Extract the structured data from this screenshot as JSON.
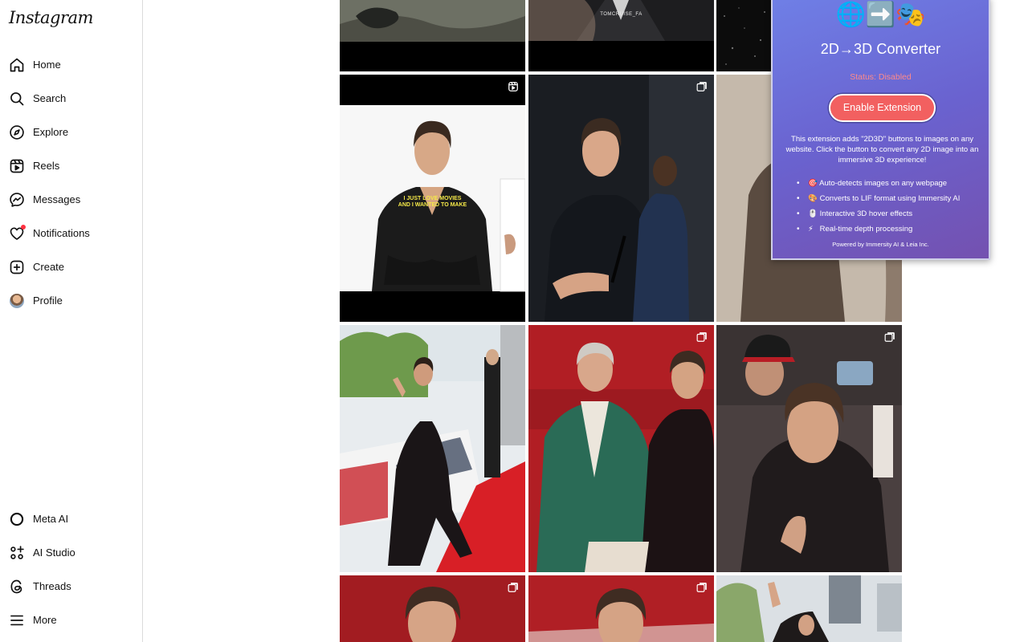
{
  "app": {
    "logo": "Instagram"
  },
  "sidebar": {
    "items": [
      {
        "label": "Home",
        "icon": "home-icon"
      },
      {
        "label": "Search",
        "icon": "search-icon"
      },
      {
        "label": "Explore",
        "icon": "compass-icon"
      },
      {
        "label": "Reels",
        "icon": "reels-icon"
      },
      {
        "label": "Messages",
        "icon": "messenger-icon"
      },
      {
        "label": "Notifications",
        "icon": "heart-icon"
      },
      {
        "label": "Create",
        "icon": "plus-square-icon"
      },
      {
        "label": "Profile",
        "icon": "avatar"
      }
    ],
    "bottom_items": [
      {
        "label": "Meta AI",
        "icon": "meta-ai-icon"
      },
      {
        "label": "AI Studio",
        "icon": "ai-studio-icon"
      },
      {
        "label": "Threads",
        "icon": "threads-icon"
      },
      {
        "label": "More",
        "icon": "menu-icon"
      }
    ]
  },
  "grid": {
    "tiles": [
      {
        "name": "post-1",
        "badge": "none",
        "caption": ""
      },
      {
        "name": "post-2",
        "badge": "none",
        "caption": "TOMCRUISE_FA"
      },
      {
        "name": "post-3",
        "badge": "none",
        "caption": ""
      },
      {
        "name": "post-4",
        "badge": "reel-icon",
        "caption": "I JUST LOVE MOVIES\nAND I WANTED TO MAKE"
      },
      {
        "name": "post-5",
        "badge": "carousel-icon",
        "caption": ""
      },
      {
        "name": "post-6",
        "badge": "none",
        "caption": ""
      },
      {
        "name": "post-7",
        "badge": "none",
        "caption": ""
      },
      {
        "name": "post-8",
        "badge": "carousel-icon",
        "caption": ""
      },
      {
        "name": "post-9",
        "badge": "carousel-icon",
        "caption": ""
      },
      {
        "name": "post-10",
        "badge": "carousel-icon",
        "caption": ""
      },
      {
        "name": "post-11",
        "badge": "carousel-icon",
        "caption": ""
      },
      {
        "name": "post-12",
        "badge": "none",
        "caption": ""
      }
    ],
    "reel_caption_line1": "I JUST LOVE MOVIES",
    "reel_caption_line2": "AND I WANTED TO MAKE",
    "top_caption": "TOMCRUISE_FA"
  },
  "extension": {
    "emojis": "🌐➡️🎭",
    "title": "2D→3D Converter",
    "status": "Status: Disabled",
    "button_label": "Enable Extension",
    "description": "This extension adds \"2D3D\" buttons to images on any website. Click the button to convert any 2D image into an immersive 3D experience!",
    "features": [
      {
        "emoji": "🎯",
        "text": "Auto-detects images on any webpage"
      },
      {
        "emoji": "🎨",
        "text": "Converts to LIF format using Immersity AI"
      },
      {
        "emoji": "🖱️",
        "text": "Interactive 3D hover effects"
      },
      {
        "emoji": "⚡",
        "text": "Real-time depth processing"
      }
    ],
    "footer": "Powered by Immersity AI & Leia Inc.",
    "colors": {
      "gradient_start": "#6f7fe6",
      "gradient_end": "#7451b0",
      "button": "#f26060",
      "status": "#ff8a8a"
    }
  }
}
